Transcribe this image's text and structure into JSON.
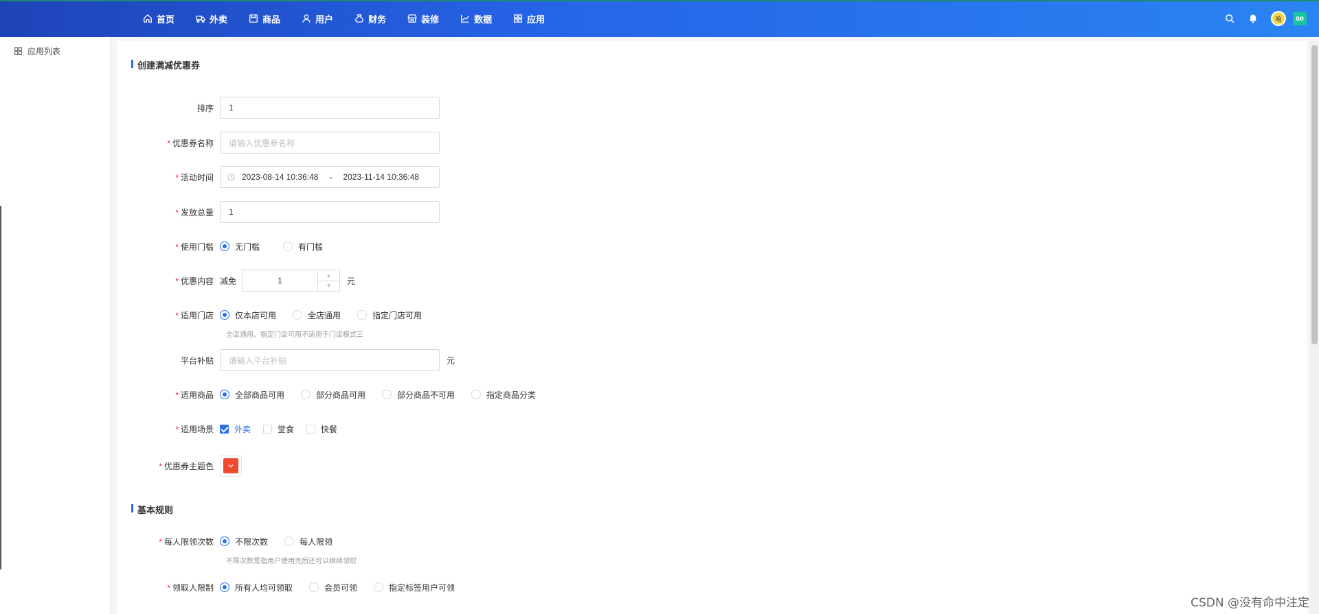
{
  "nav": {
    "items": [
      {
        "label": "首页",
        "icon": "home-icon"
      },
      {
        "label": "外卖",
        "icon": "takeout-icon"
      },
      {
        "label": "商品",
        "icon": "goods-icon"
      },
      {
        "label": "用户",
        "icon": "user-icon"
      },
      {
        "label": "财务",
        "icon": "finance-icon"
      },
      {
        "label": "装修",
        "icon": "store-icon"
      },
      {
        "label": "数据",
        "icon": "chart-icon"
      },
      {
        "label": "应用",
        "icon": "apps-icon"
      }
    ],
    "avatar_text": "哈",
    "app_badge": "ae"
  },
  "sidebar": {
    "item_label": "应用列表"
  },
  "sections": {
    "create_title": "创建满减优惠券",
    "rules_title": "基本规则"
  },
  "form": {
    "sort": {
      "label": "排序",
      "value": "1"
    },
    "name": {
      "label": "优惠券名称",
      "placeholder": "请输入优惠券名称"
    },
    "time": {
      "label": "活动时间",
      "start": "2023-08-14 10:36:48",
      "separator": "-",
      "end": "2023-11-14 10:36:48"
    },
    "total": {
      "label": "发放总量",
      "value": "1"
    },
    "threshold": {
      "label": "使用门槛",
      "options": [
        "无门槛",
        "有门槛"
      ]
    },
    "content": {
      "label": "优惠内容",
      "prefix": "减免",
      "value": "1",
      "unit": "元"
    },
    "store": {
      "label": "适用门店",
      "options": [
        "仅本店可用",
        "全店通用",
        "指定门店可用"
      ],
      "hint": "全店通用、指定门店可用不适用于门店模式三"
    },
    "subsidy": {
      "label": "平台补贴",
      "placeholder": "请输入平台补贴",
      "unit": "元"
    },
    "goods": {
      "label": "适用商品",
      "options": [
        "全部商品可用",
        "部分商品可用",
        "部分商品不可用",
        "指定商品分类"
      ]
    },
    "scene": {
      "label": "适用场景",
      "options": [
        "外卖",
        "堂食",
        "快餐"
      ]
    },
    "color": {
      "label": "优惠券主题色",
      "value": "#f04a2e"
    },
    "limit_per": {
      "label": "每人限领次数",
      "options": [
        "不限次数",
        "每人限领"
      ],
      "hint": "不限次数是指用户使用完后还可以继续领取"
    },
    "receiver": {
      "label": "领取人限制",
      "options": [
        "所有人均可领取",
        "会员可领",
        "指定标签用户可领"
      ]
    }
  },
  "watermark": "CSDN @没有命中注定"
}
